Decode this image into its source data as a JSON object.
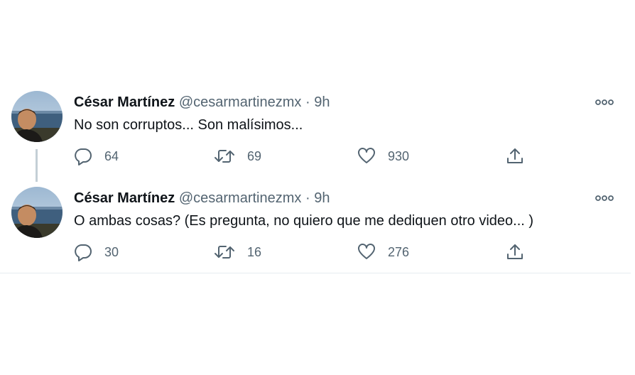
{
  "tweets": [
    {
      "author_name": "César Martínez",
      "handle": "@cesarmartinezmx",
      "separator": "·",
      "time": "9h",
      "text": "No son corruptos... Son malísimos...",
      "replies": "64",
      "retweets": "69",
      "likes": "930"
    },
    {
      "author_name": "César Martínez",
      "handle": "@cesarmartinezmx",
      "separator": "·",
      "time": "9h",
      "text": "O ambas cosas?  (Es pregunta, no quiero que me dediquen otro video... )",
      "replies": "30",
      "retweets": "16",
      "likes": "276"
    }
  ],
  "icons": {
    "reply": "speech-bubble-icon",
    "retweet": "retweet-arrows-icon",
    "like": "heart-icon",
    "share": "share-upload-icon",
    "more": "more-dots-icon"
  },
  "colors": {
    "text_primary": "#0f1419",
    "text_secondary": "#536471",
    "thread_line": "#c4cfd6"
  }
}
